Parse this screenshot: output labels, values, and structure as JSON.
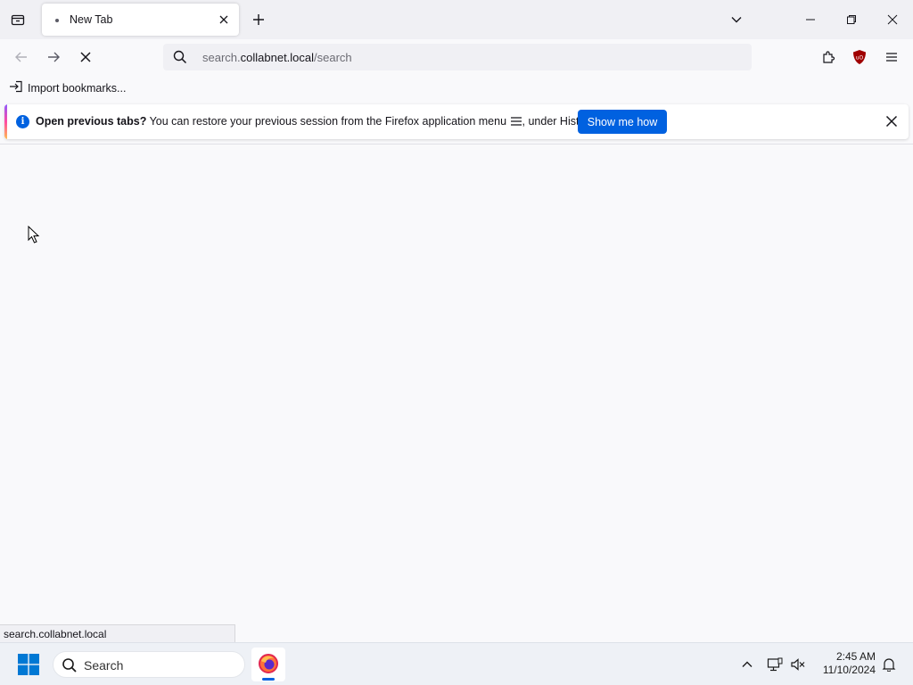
{
  "browser": {
    "tab": {
      "title": "New Tab"
    },
    "url": {
      "prefix": "search.",
      "host": "collabnet.local",
      "path": "/search"
    },
    "bookmarks_toolbar": {
      "import_label": "Import bookmarks..."
    },
    "notification": {
      "title": "Open previous tabs?",
      "message": "You can restore your previous session from the Firefox application menu",
      "suffix": ", under History.",
      "button_label": "Show me how"
    },
    "status_text": "search.collabnet.local"
  },
  "taskbar": {
    "search_placeholder": "Search",
    "time": "2:45 AM",
    "date": "11/10/2024"
  },
  "colors": {
    "accent": "#0061e0",
    "extension_shield": "#a00000"
  },
  "icons": [
    "list-all-tabs-icon",
    "close-icon",
    "plus-icon",
    "chevron-down-icon",
    "minimize-icon",
    "restore-icon",
    "back-icon",
    "forward-icon",
    "stop-icon",
    "search-icon",
    "extensions-icon",
    "ublock-icon",
    "hamburger-menu-icon",
    "import-icon",
    "info-icon",
    "windows-start-icon",
    "firefox-icon",
    "chevron-up-icon",
    "network-icon",
    "volume-muted-icon",
    "notification-bell-icon",
    "mouse-cursor-icon"
  ]
}
